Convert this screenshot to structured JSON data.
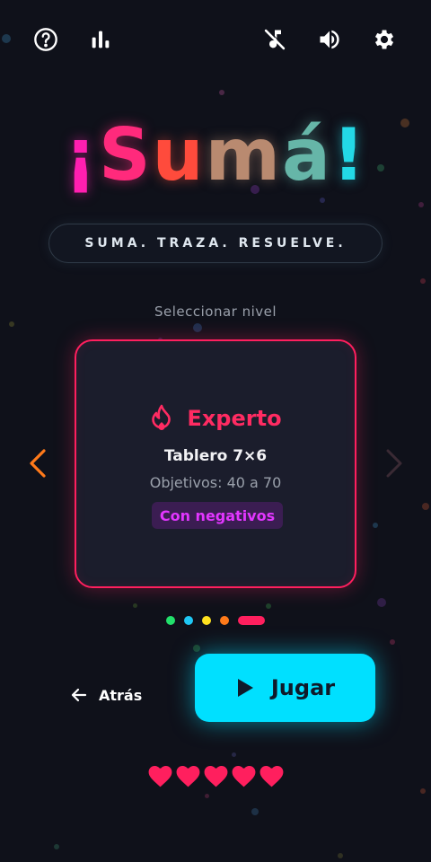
{
  "colors": {
    "background": "#0f111a",
    "accent_red": "#ff1f5e",
    "accent_cyan": "#00e0ff",
    "accent_orange": "#ff7a1a",
    "badge_magenta": "#e236ff"
  },
  "topbar": {
    "icons": [
      "help-icon",
      "stats-icon",
      "music-off-icon",
      "volume-icon",
      "gear-icon"
    ]
  },
  "title": {
    "letters": [
      {
        "char": "¡",
        "color": "#ff1fb0"
      },
      {
        "char": "S",
        "color": "#ff2a7c"
      },
      {
        "char": "u",
        "color": "#ff4b3c"
      },
      {
        "char": "m",
        "color": "#b98a70"
      },
      {
        "char": "á",
        "color": "#66b6a8"
      },
      {
        "char": "!",
        "color": "#23d9e6"
      }
    ]
  },
  "tagline": "SUMA. TRAZA. RESUELVE.",
  "level_select": {
    "label": "Seleccionar nivel",
    "card": {
      "name": "Experto",
      "board": "Tablero 7×6",
      "goals": "Objetivos: 40 a 70",
      "badge": "Con negativos"
    },
    "pager": {
      "dots": [
        "#22e06b",
        "#1fc8f5",
        "#ffe21f",
        "#ff7a1a",
        "#ff1f5e"
      ],
      "active_index": 4
    }
  },
  "actions": {
    "back_label": "Atrás",
    "play_label": "Jugar"
  },
  "lives": {
    "count": 5,
    "max": 5
  }
}
